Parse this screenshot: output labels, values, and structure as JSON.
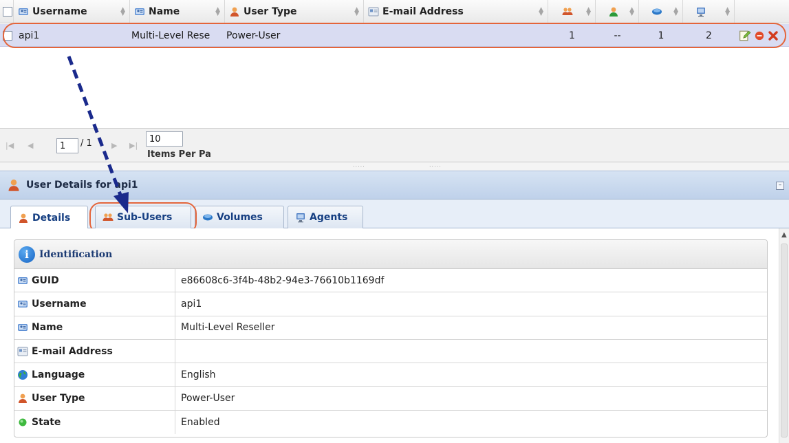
{
  "grid": {
    "columns": [
      {
        "label": "Username",
        "icon": "user-card-icon"
      },
      {
        "label": "Name",
        "icon": "user-card-icon"
      },
      {
        "label": "User Type",
        "icon": "user-type-icon"
      },
      {
        "label": "E-mail Address",
        "icon": "email-card-icon"
      },
      {
        "label": "",
        "icon": "sub-users-icon"
      },
      {
        "label": "",
        "icon": "user-icon"
      },
      {
        "label": "",
        "icon": "volume-icon"
      },
      {
        "label": "",
        "icon": "agent-icon"
      }
    ],
    "rows": [
      {
        "username": "api1",
        "name": "Multi-Level Rese",
        "user_type": "Power-User",
        "email": "",
        "sub_users": "1",
        "users": "--",
        "volumes": "1",
        "agents": "2"
      }
    ]
  },
  "pager": {
    "page": "1",
    "of_label": "/ 1",
    "items_per_page": "10",
    "items_per_page_label": "Items Per Pa"
  },
  "details": {
    "title": "User Details for api1",
    "tabs": [
      {
        "label": "Details",
        "icon": "user-type-icon"
      },
      {
        "label": "Sub-Users",
        "icon": "sub-users-icon"
      },
      {
        "label": "Volumes",
        "icon": "volume-icon"
      },
      {
        "label": "Agents",
        "icon": "agent-icon"
      }
    ],
    "section_title": "Identification",
    "fields": [
      {
        "label": "GUID",
        "value": "e86608c6-3f4b-48b2-94e3-76610b1169df",
        "icon": "user-card-icon"
      },
      {
        "label": "Username",
        "value": "api1",
        "icon": "user-card-icon"
      },
      {
        "label": "Name",
        "value": "Multi-Level Reseller",
        "icon": "user-card-icon"
      },
      {
        "label": "E-mail Address",
        "value": "",
        "icon": "email-card-icon"
      },
      {
        "label": "Language",
        "value": "English",
        "icon": "globe-icon"
      },
      {
        "label": "User Type",
        "value": "Power-User",
        "icon": "user-type-icon"
      },
      {
        "label": "State",
        "value": "Enabled",
        "icon": "status-dot-icon"
      }
    ]
  },
  "colors": {
    "highlight_outline": "#e4653b",
    "arrow": "#1a2a8c",
    "selected_row": "#d9dcf2",
    "tab_text": "#163f82"
  }
}
